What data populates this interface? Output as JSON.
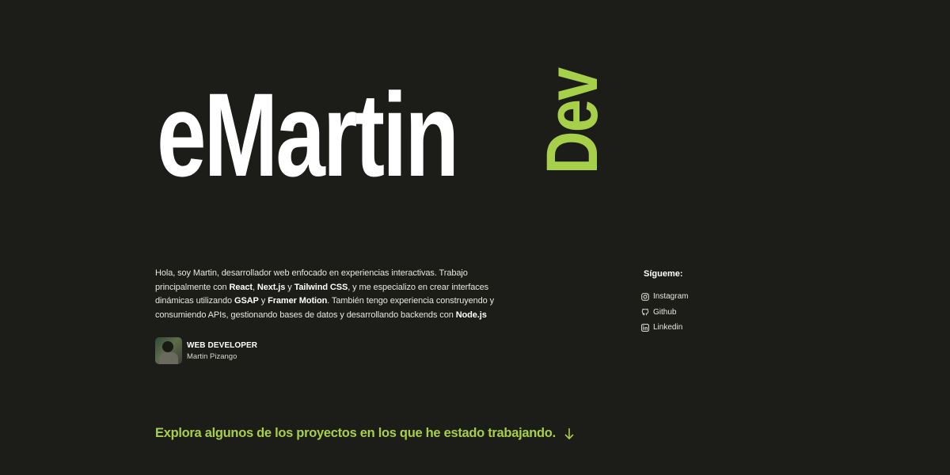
{
  "hero": {
    "name": "eMartin",
    "suffix": "Dev"
  },
  "intro": {
    "t1": "Hola, soy Martin, desarrollador web enfocado en experiencias interactivas. Trabajo principalmente con ",
    "b1": "React",
    "t2": ", ",
    "b2": "Next.js",
    "t3": " y ",
    "b3": "Tailwind CSS",
    "t4": ", y me especializo en crear interfaces dinámicas utilizando ",
    "b4": "GSAP",
    "t5": " y ",
    "b5": "Framer Motion",
    "t6": ". También tengo experiencia construyendo y consumiendo APIs, gestionando bases de datos y desarrollando backends con ",
    "b6": "Node.js"
  },
  "profile": {
    "role": "WEB DEVELOPER",
    "name": "Martin Pizango"
  },
  "social": {
    "title": "Sígueme:",
    "links": [
      {
        "label": "Instagram",
        "icon": "instagram-icon"
      },
      {
        "label": "Github",
        "icon": "github-icon"
      },
      {
        "label": "Linkedin",
        "icon": "linkedin-icon"
      }
    ]
  },
  "cta": {
    "text": "Explora algunos de los proyectos en los que he estado trabajando.",
    "icon": "arrow-down-icon"
  },
  "colors": {
    "background": "#1c1c18",
    "accent": "#a6cf4a",
    "text": "#ffffff"
  }
}
